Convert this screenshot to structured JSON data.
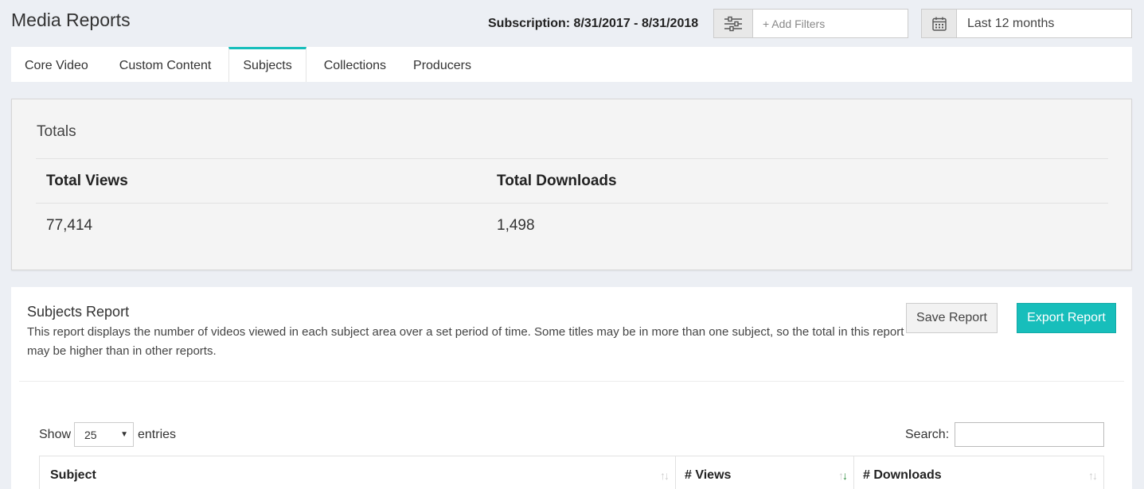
{
  "header": {
    "title": "Media Reports",
    "subscription": "Subscription: 8/31/2017 - 8/31/2018",
    "filters_placeholder": "+ Add Filters",
    "date_range": "Last 12 months"
  },
  "tabs": [
    {
      "label": "Core Video",
      "active": false
    },
    {
      "label": "Custom Content",
      "active": false
    },
    {
      "label": "Subjects",
      "active": true
    },
    {
      "label": "Collections",
      "active": false
    },
    {
      "label": "Producers",
      "active": false
    }
  ],
  "totals": {
    "title": "Totals",
    "headers": [
      "Total Views",
      "Total Downloads"
    ],
    "values": [
      "77,414",
      "1,498"
    ]
  },
  "report": {
    "title": "Subjects Report",
    "description": "This report displays the number of videos viewed in each subject area over a set period of time. Some titles may be in more than one subject, so the total in this report may be higher than in other reports.",
    "save_label": "Save Report",
    "export_label": "Export Report",
    "show_label": "Show",
    "entries_value": "25",
    "entries_label": "entries",
    "search_label": "Search:",
    "search_value": "",
    "columns": [
      "Subject",
      "# Views",
      "# Downloads"
    ]
  },
  "colors": {
    "accent": "#17bebb",
    "background": "#eceff4"
  }
}
